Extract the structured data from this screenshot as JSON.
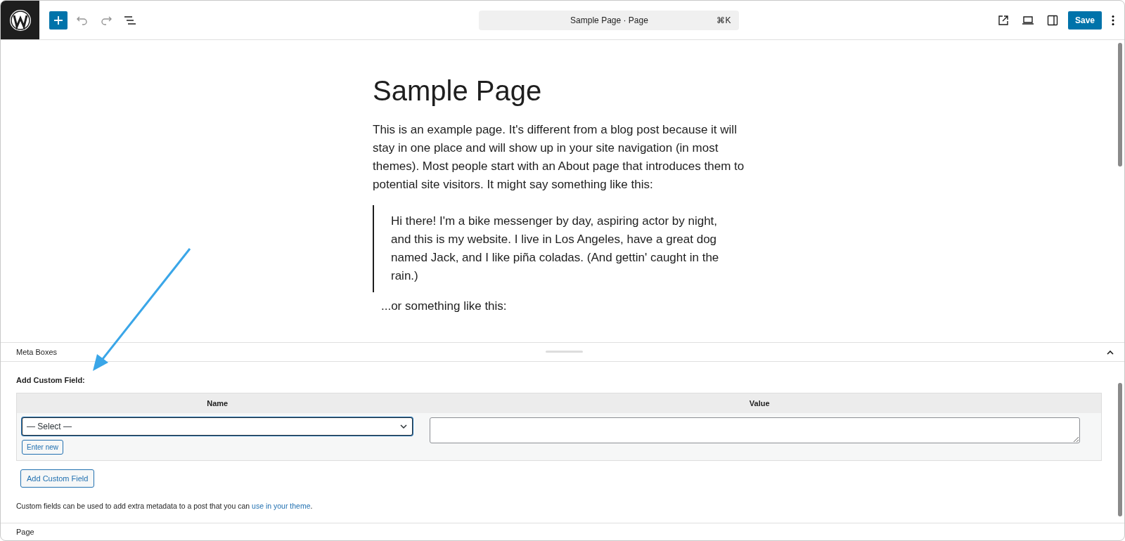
{
  "command_bar": {
    "title": "Sample Page · Page",
    "shortcut": "⌘K"
  },
  "save_button": "Save",
  "content": {
    "title": "Sample Page",
    "paragraph": "This is an example page. It's different from a blog post because it will stay in one place and will show up in your site navigation (in most themes). Most people start with an About page that introduces them to potential site visitors. It might say something like this:",
    "quote": "Hi there! I'm a bike messenger by day, aspiring actor by night, and this is my website. I live in Los Angeles, have a great dog named Jack, and I like piña coladas. (And gettin' caught in the rain.)",
    "paragraph_2": "...or something like this:"
  },
  "meta_boxes": {
    "title": "Meta Boxes",
    "expanded": true,
    "section_title": "Add Custom Field:",
    "columns": [
      "Name",
      "Value"
    ],
    "select": {
      "value": "— Select —"
    },
    "enter_new_button": "Enter new",
    "add_button": "Add Custom Field",
    "help_text": "Custom fields can be used to add extra metadata to a post that you can ",
    "help_link": "use in your theme",
    "help_end": "."
  },
  "footer": {
    "breadcrumb": "Page"
  }
}
